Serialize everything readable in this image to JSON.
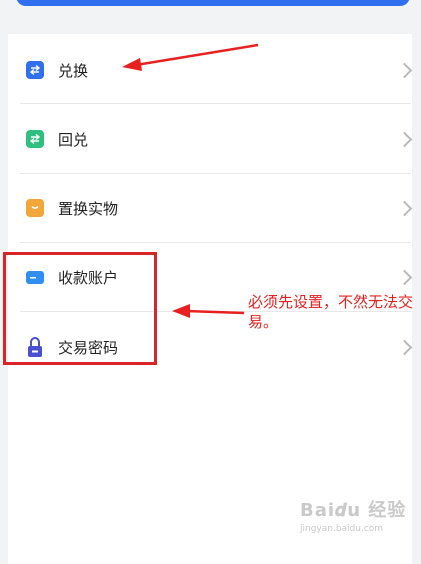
{
  "menu": {
    "items": [
      {
        "label": "兑换",
        "icon": "exchange-icon",
        "color": "#2f6ff0"
      },
      {
        "label": "回兑",
        "icon": "reverse-exchange-icon",
        "color": "#2fc07f"
      },
      {
        "label": "置换实物",
        "icon": "gift-bag-icon",
        "color": "#f3a63a"
      },
      {
        "label": "收款账户",
        "icon": "card-icon",
        "color": "#2f8ff0"
      },
      {
        "label": "交易密码",
        "icon": "lock-icon",
        "color": "#4a4fd0"
      }
    ]
  },
  "annotation": {
    "text": "必须先设置，不然无法交易。",
    "color": "#e8201f"
  },
  "watermark": {
    "logo": "Bai𝒅u 经验",
    "url": "jingyan.baidu.com"
  }
}
